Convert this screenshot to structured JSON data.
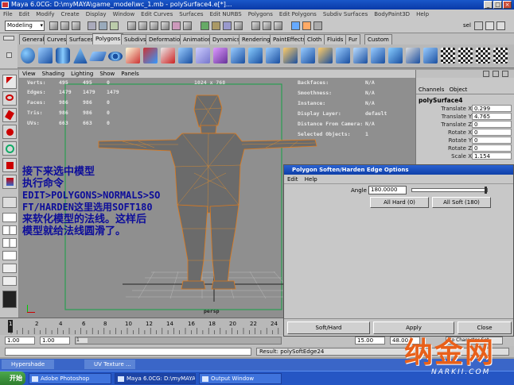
{
  "window": {
    "title": "Maya 6.0CG: D:\\myMAYA\\game_model\\wc_1.mb  -  polySurface4.e[*]...",
    "controls": [
      "_",
      "□",
      "×"
    ]
  },
  "menu_bar": [
    "File",
    "Edit",
    "Modify",
    "Create",
    "Display",
    "Window",
    "Edit Curves",
    "Surfaces",
    "Edit NURBS",
    "Polygons",
    "Edit Polygons",
    "Subdiv Surfaces",
    "BodyPaint3D",
    "Help"
  ],
  "status_line": {
    "mode": "Modeling",
    "selection_label": "sel"
  },
  "shelf_tabs": [
    "General",
    "Curves",
    "Surfaces",
    "Polygons",
    "Subdivs",
    "Deformation",
    "Animation",
    "Dynamics",
    "Rendering",
    "PaintEffects",
    "Cloth",
    "Fluids",
    "Fur",
    "Custom"
  ],
  "shelf_active_tab": "Polygons",
  "panel_menu": [
    "View",
    "Shading",
    "Lighting",
    "Show",
    "Panels"
  ],
  "viewport": {
    "resolution": "1024 x 768",
    "camera": "persp",
    "hud_left": [
      {
        "label": "Verts:",
        "a": "495",
        "b": "495",
        "c": "0"
      },
      {
        "label": "Edges:",
        "a": "1479",
        "b": "1479",
        "c": "1479"
      },
      {
        "label": "Faces:",
        "a": "986",
        "b": "986",
        "c": "0"
      },
      {
        "label": "Tris:",
        "a": "986",
        "b": "986",
        "c": "0"
      },
      {
        "label": "UVs:",
        "a": "663",
        "b": "663",
        "c": "0"
      }
    ],
    "hud_right": [
      {
        "label": "Backfaces:",
        "value": "N/A"
      },
      {
        "label": "Smoothness:",
        "value": "N/A"
      },
      {
        "label": "Instance:",
        "value": "N/A"
      },
      {
        "label": "Display Layer:",
        "value": "default"
      },
      {
        "label": "Distance From Camera:",
        "value": "N/A"
      },
      {
        "label": "Selected Objects:",
        "value": "1"
      }
    ],
    "annotation": [
      "接下来选中模型",
      "执行命令",
      "EDIT>POLYGONS>NORMALS>SO",
      "FT/HARDEN这里选用SOFT180",
      "来软化模型的法线。这样后",
      "模型就给法线圆滑了。"
    ]
  },
  "channel_box": {
    "tabs": [
      "Channels",
      "Object"
    ],
    "object": "polySurface4",
    "attrs": [
      {
        "label": "Translate X",
        "value": "0.299"
      },
      {
        "label": "Translate Y",
        "value": "4.765"
      },
      {
        "label": "Translate Z",
        "value": "0"
      },
      {
        "label": "Rotate X",
        "value": "0"
      },
      {
        "label": "Rotate Y",
        "value": "0"
      },
      {
        "label": "Rotate Z",
        "value": "0"
      },
      {
        "label": "Scale X",
        "value": "1.154"
      }
    ]
  },
  "dialog": {
    "title": "Polygon Soften/Harden Edge Options",
    "menu": [
      "Edit",
      "Help"
    ],
    "angle_label": "Angle",
    "angle_value": "180.0000",
    "angle_fraction": 1.0,
    "preset_buttons": [
      "All Hard (0)",
      "All Soft (180)"
    ],
    "footer_buttons": [
      "Soft/Hard",
      "Apply",
      "Close"
    ]
  },
  "timeline": {
    "ticks": [
      "1",
      "2",
      "4",
      "6",
      "8",
      "10",
      "12",
      "14",
      "16",
      "18",
      "20",
      "22",
      "24"
    ]
  },
  "range": {
    "start": "1.00",
    "current": "1.00",
    "frame": "1",
    "end_a": "15.00",
    "end_b": "48.00",
    "char_set": "No Character Set"
  },
  "command_line": {
    "result": "Result: polySoftEdge24"
  },
  "minimized_windows": [
    "Hypershade",
    "UV Texture ..."
  ],
  "taskbar": {
    "start": "开始",
    "tasks": [
      "Adobe Photoshop",
      "Maya 6.0CG: D:\\myMAYA\\...",
      "Output Window"
    ]
  },
  "watermark": {
    "text": "纳金网",
    "sub": "NARKII.COM"
  },
  "colors": {
    "wire": "#e07a1a",
    "accent": "#2a62d2",
    "annotation": "#0d0d9a"
  }
}
